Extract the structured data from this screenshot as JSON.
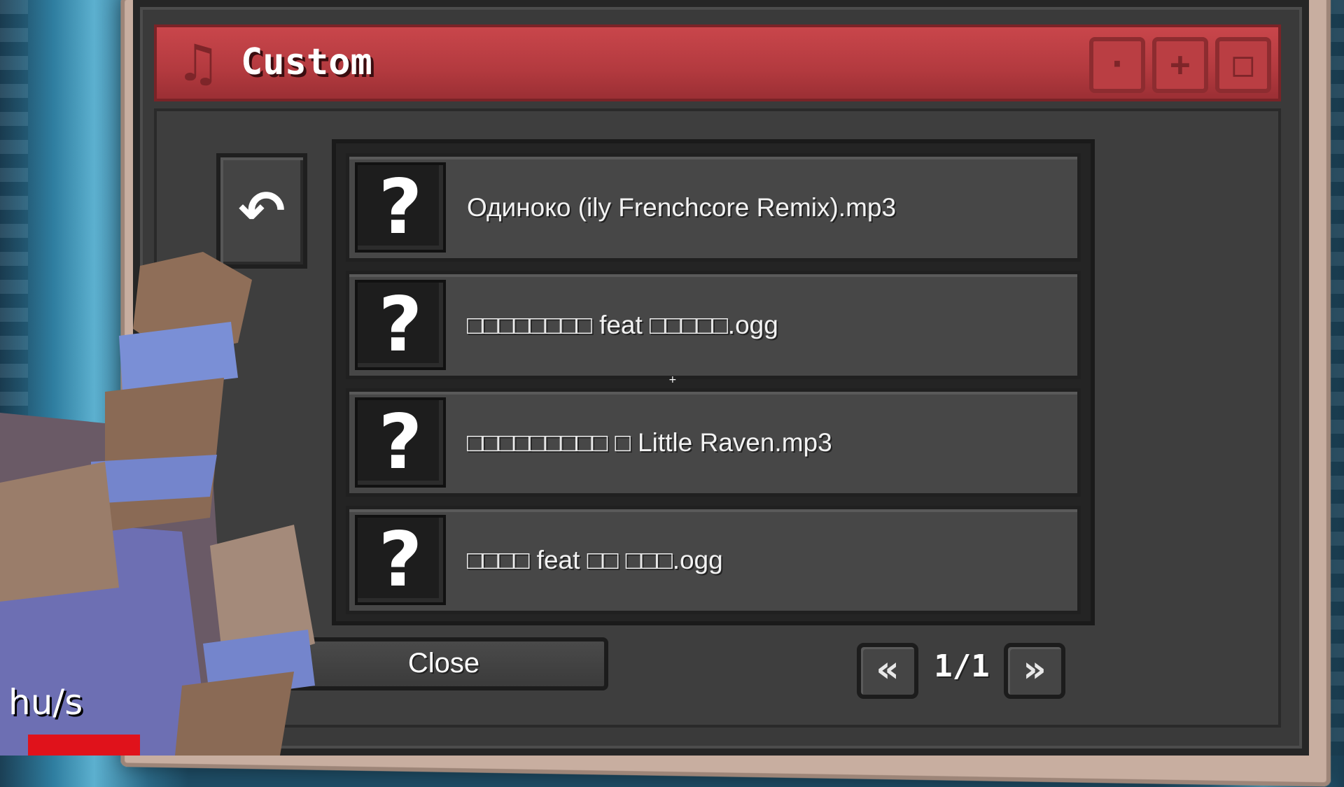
{
  "window": {
    "title": "Custom",
    "title_icon": "music-note-icon",
    "controls": [
      {
        "name": "minimize-button",
        "glyph": "·"
      },
      {
        "name": "add-button",
        "glyph": "+"
      },
      {
        "name": "maximize-button",
        "glyph": "□"
      }
    ]
  },
  "back": {
    "icon": "undo-arrow-icon",
    "glyph": "↶"
  },
  "tracks": [
    {
      "name": "Одиноко (ily Frenchcore Remix).mp3",
      "art": "?"
    },
    {
      "name": "□□□□□□□□ feat □□□□□.ogg",
      "art": "?"
    },
    {
      "name": "□□□□□□□□□ □ Little Raven.mp3",
      "art": "?"
    },
    {
      "name": "□□□□ feat □□ □□□.ogg",
      "art": "?"
    }
  ],
  "footer": {
    "close_label": "Close",
    "prev_glyph": "«",
    "next_glyph": "»",
    "page": "1/1"
  },
  "hud": {
    "speed_unit": "hu/s"
  },
  "colors": {
    "titlebar": "#c9464b",
    "window_bg": "#3a3a3a",
    "health": "#e0121b"
  }
}
